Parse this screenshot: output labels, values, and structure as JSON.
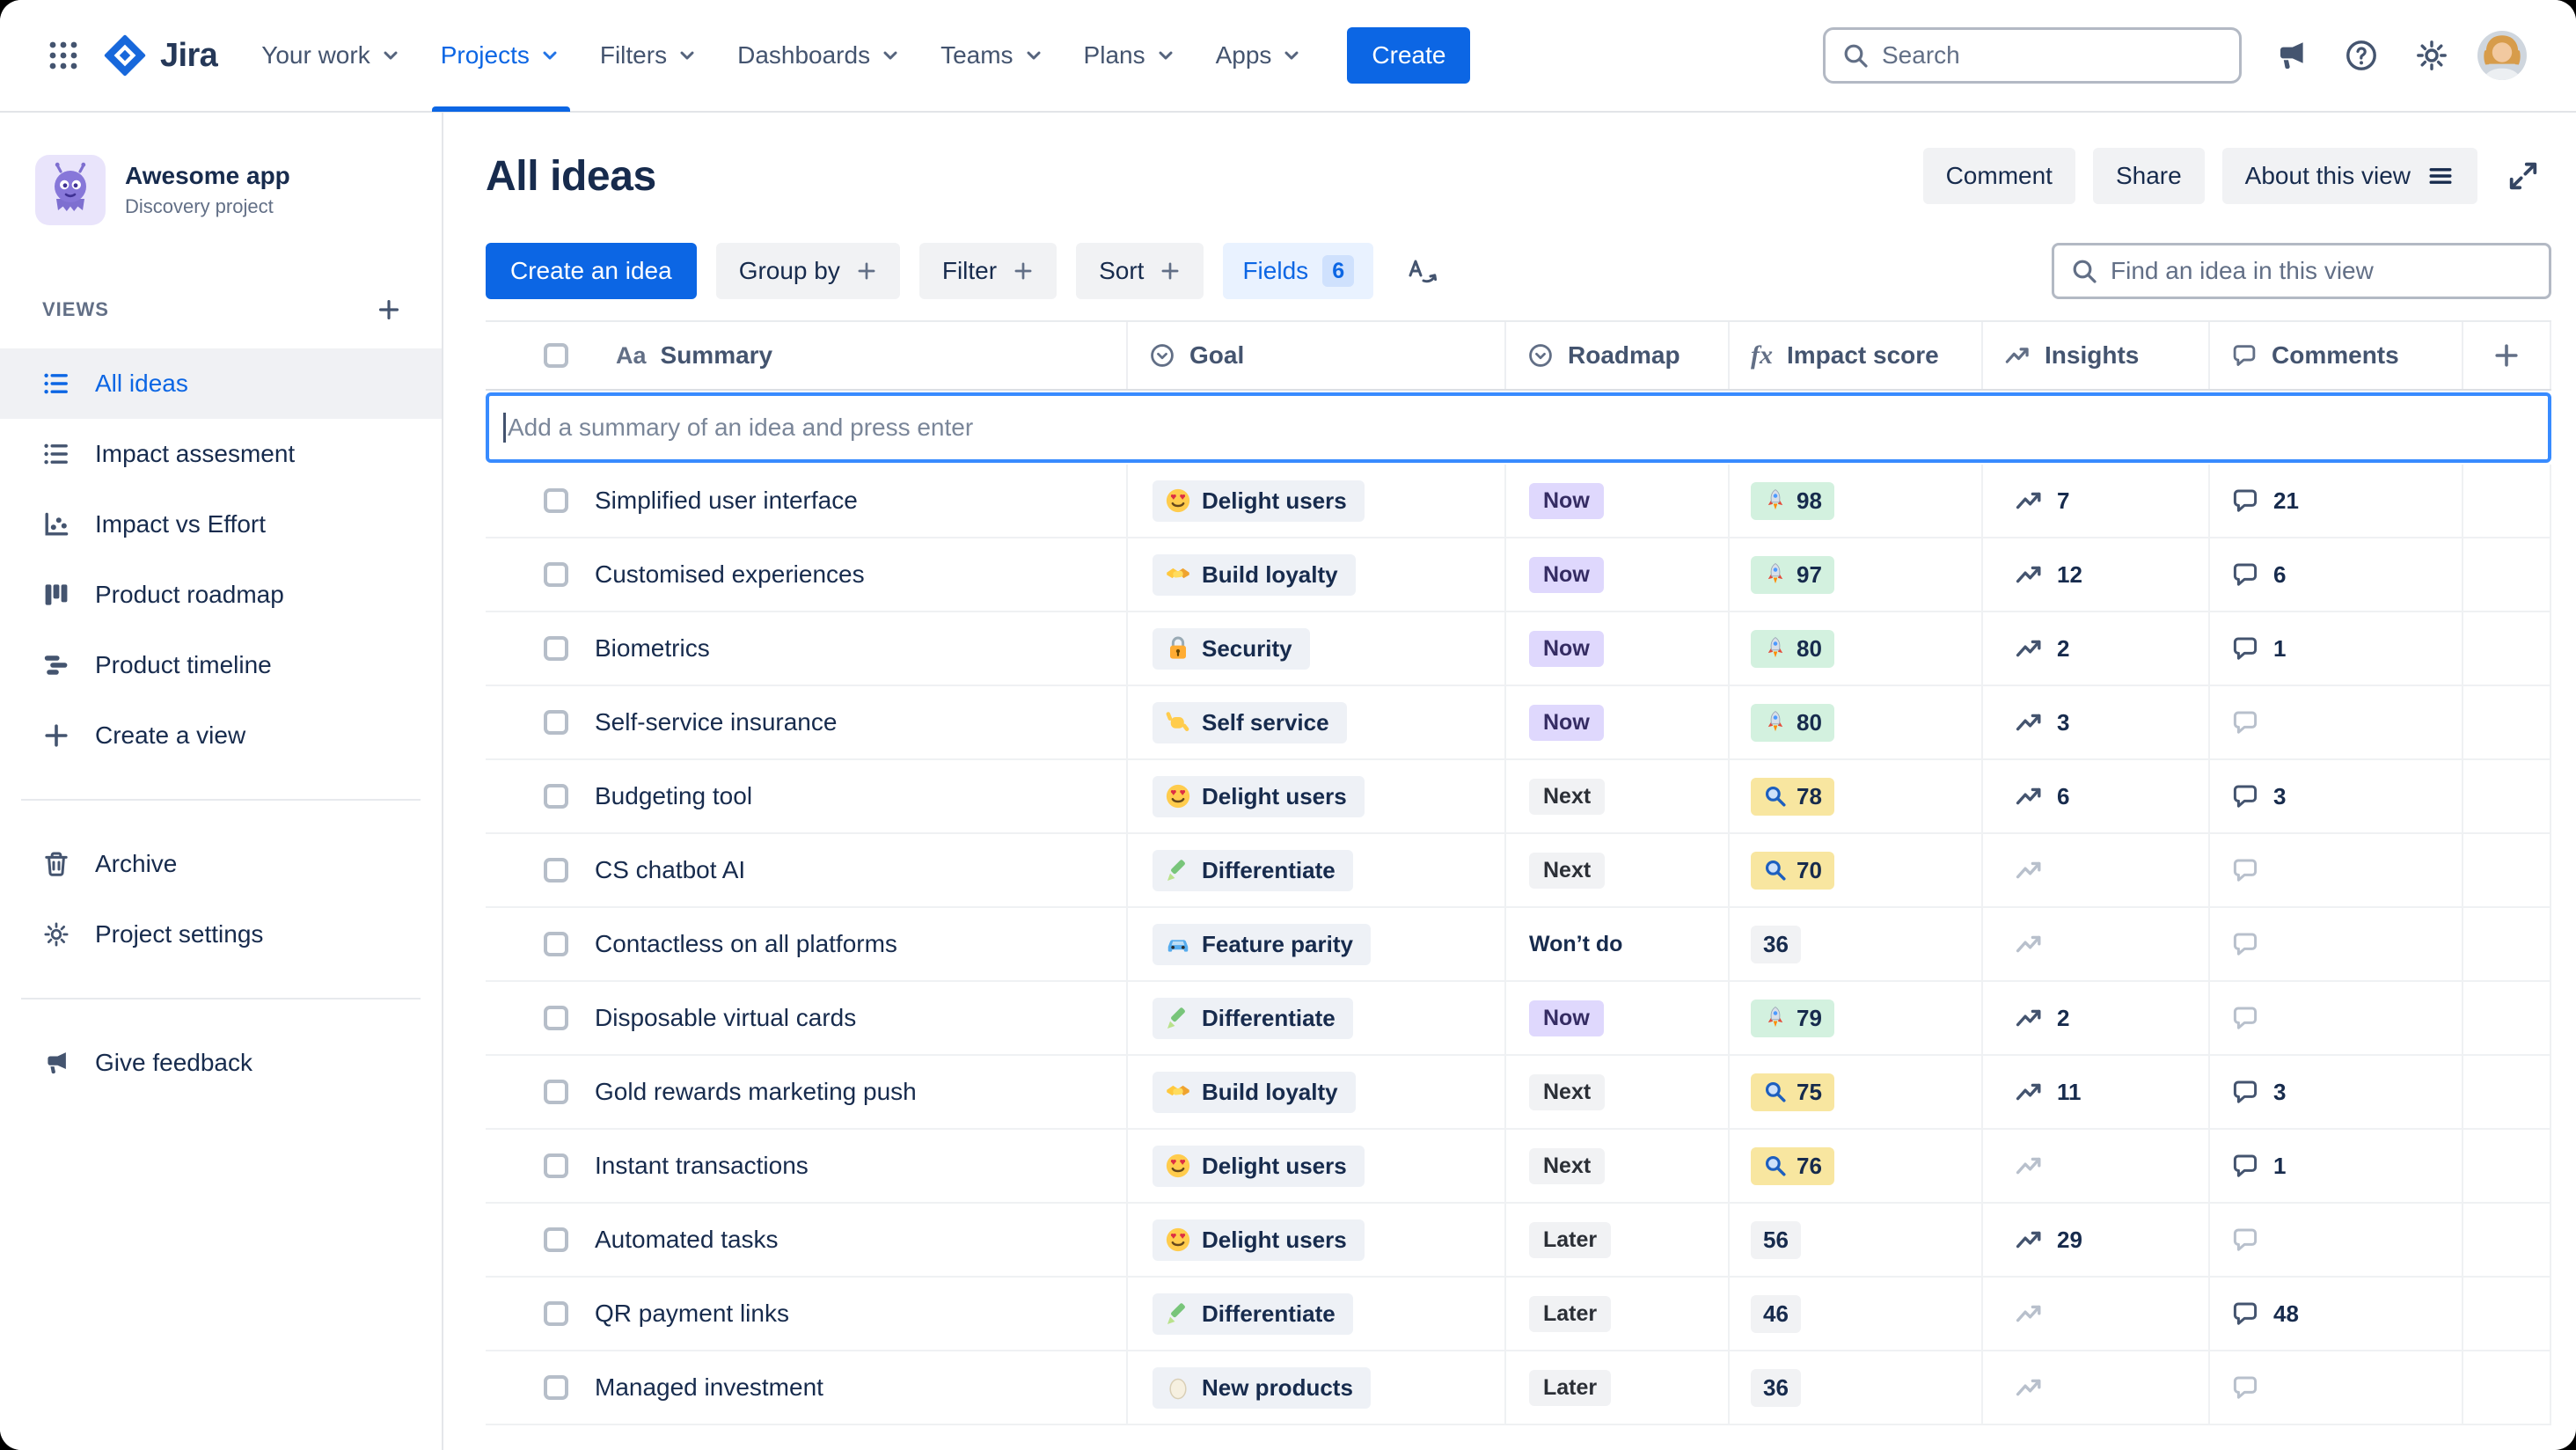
{
  "colors": {
    "brand_blue": "#0C66E4",
    "focus_blue": "#388BFF",
    "text": "#172B4D",
    "subtle_text": "#626F86",
    "roadmap_now_bg": "#DFD8FD",
    "roadmap_now_text": "#352C63",
    "neutral_badge_bg": "#F1F2F4",
    "impact_high_bg": "#D3F1DF",
    "impact_medium_bg": "#F8E6A0",
    "impact_low_bg": "#F1F2F4",
    "goal_chip_bg": "#EEF1F6"
  },
  "topnav": {
    "brand": "Jira",
    "items": [
      {
        "label": "Your work"
      },
      {
        "label": "Projects",
        "active": true
      },
      {
        "label": "Filters"
      },
      {
        "label": "Dashboards"
      },
      {
        "label": "Teams"
      },
      {
        "label": "Plans"
      },
      {
        "label": "Apps"
      }
    ],
    "create_label": "Create",
    "search_placeholder": "Search"
  },
  "sidebar": {
    "project_name": "Awesome app",
    "project_type": "Discovery project",
    "views_header": "VIEWS",
    "views": [
      {
        "label": "All ideas",
        "icon": "list",
        "active": true
      },
      {
        "label": "Impact assesment",
        "icon": "list"
      },
      {
        "label": "Impact vs Effort",
        "icon": "scatter"
      },
      {
        "label": "Product roadmap",
        "icon": "board"
      },
      {
        "label": "Product timeline",
        "icon": "timeline"
      }
    ],
    "create_view_label": "Create a view",
    "archive_label": "Archive",
    "settings_label": "Project settings",
    "feedback_label": "Give feedback"
  },
  "header": {
    "title": "All ideas",
    "comment_label": "Comment",
    "share_label": "Share",
    "about_label": "About this view"
  },
  "toolbar": {
    "create_idea_label": "Create an idea",
    "group_by_label": "Group by",
    "filter_label": "Filter",
    "sort_label": "Sort",
    "fields_label": "Fields",
    "fields_count": "6",
    "find_placeholder": "Find an idea in this view"
  },
  "table": {
    "add_placeholder": "Add a summary of an idea and press enter",
    "columns": [
      {
        "label": "Summary",
        "icon": "text",
        "glyph": "Aa"
      },
      {
        "label": "Goal",
        "icon": "select"
      },
      {
        "label": "Roadmap",
        "icon": "select"
      },
      {
        "label": "Impact score",
        "icon": "formula",
        "glyph": "fx"
      },
      {
        "label": "Insights",
        "icon": "trend"
      },
      {
        "label": "Comments",
        "icon": "comment"
      }
    ],
    "rows": [
      {
        "summary": "Simplified user interface",
        "goal": {
          "label": "Delight users",
          "icon": "delight"
        },
        "roadmap": {
          "label": "Now",
          "variant": "purple"
        },
        "impact": {
          "value": 98,
          "variant": "green",
          "icon": "rocket"
        },
        "insights": 7,
        "comments": 21
      },
      {
        "summary": "Customised experiences",
        "goal": {
          "label": "Build loyalty",
          "icon": "loyalty"
        },
        "roadmap": {
          "label": "Now",
          "variant": "purple"
        },
        "impact": {
          "value": 97,
          "variant": "green",
          "icon": "rocket"
        },
        "insights": 12,
        "comments": 6
      },
      {
        "summary": "Biometrics",
        "goal": {
          "label": "Security",
          "icon": "security"
        },
        "roadmap": {
          "label": "Now",
          "variant": "purple"
        },
        "impact": {
          "value": 80,
          "variant": "green",
          "icon": "rocket"
        },
        "insights": 2,
        "comments": 1
      },
      {
        "summary": "Self-service insurance",
        "goal": {
          "label": "Self service",
          "icon": "selfservice"
        },
        "roadmap": {
          "label": "Now",
          "variant": "purple"
        },
        "impact": {
          "value": 80,
          "variant": "green",
          "icon": "rocket"
        },
        "insights": 3,
        "comments": null
      },
      {
        "summary": "Budgeting tool",
        "goal": {
          "label": "Delight users",
          "icon": "delight"
        },
        "roadmap": {
          "label": "Next",
          "variant": "gray"
        },
        "impact": {
          "value": 78,
          "variant": "yellow",
          "icon": "magnifier"
        },
        "insights": 6,
        "comments": 3
      },
      {
        "summary": "CS chatbot AI",
        "goal": {
          "label": "Differentiate",
          "icon": "differentiate"
        },
        "roadmap": {
          "label": "Next",
          "variant": "gray"
        },
        "impact": {
          "value": 70,
          "variant": "yellow",
          "icon": "magnifier"
        },
        "insights": null,
        "comments": null
      },
      {
        "summary": "Contactless on all platforms",
        "goal": {
          "label": "Feature parity",
          "icon": "car"
        },
        "roadmap": {
          "label": "Won’t do",
          "variant": "plain"
        },
        "impact": {
          "value": 36,
          "variant": "gray",
          "icon": null
        },
        "insights": null,
        "comments": null
      },
      {
        "summary": "Disposable virtual cards",
        "goal": {
          "label": "Differentiate",
          "icon": "differentiate"
        },
        "roadmap": {
          "label": "Now",
          "variant": "purple"
        },
        "impact": {
          "value": 79,
          "variant": "green",
          "icon": "rocket"
        },
        "insights": 2,
        "comments": null
      },
      {
        "summary": "Gold rewards marketing push",
        "goal": {
          "label": "Build loyalty",
          "icon": "loyalty"
        },
        "roadmap": {
          "label": "Next",
          "variant": "gray"
        },
        "impact": {
          "value": 75,
          "variant": "yellow",
          "icon": "magnifier"
        },
        "insights": 11,
        "comments": 3
      },
      {
        "summary": "Instant transactions",
        "goal": {
          "label": "Delight users",
          "icon": "delight"
        },
        "roadmap": {
          "label": "Next",
          "variant": "gray"
        },
        "impact": {
          "value": 76,
          "variant": "yellow",
          "icon": "magnifier"
        },
        "insights": null,
        "comments": 1
      },
      {
        "summary": "Automated tasks",
        "goal": {
          "label": "Delight users",
          "icon": "delight"
        },
        "roadmap": {
          "label": "Later",
          "variant": "gray"
        },
        "impact": {
          "value": 56,
          "variant": "gray",
          "icon": null
        },
        "insights": 29,
        "comments": null
      },
      {
        "summary": "QR payment links",
        "goal": {
          "label": "Differentiate",
          "icon": "differentiate"
        },
        "roadmap": {
          "label": "Later",
          "variant": "gray"
        },
        "impact": {
          "value": 46,
          "variant": "gray",
          "icon": null
        },
        "insights": null,
        "comments": 48
      },
      {
        "summary": "Managed investment",
        "goal": {
          "label": "New products",
          "icon": "egg"
        },
        "roadmap": {
          "label": "Later",
          "variant": "gray"
        },
        "impact": {
          "value": 36,
          "variant": "gray",
          "icon": null
        },
        "insights": null,
        "comments": null
      }
    ]
  }
}
